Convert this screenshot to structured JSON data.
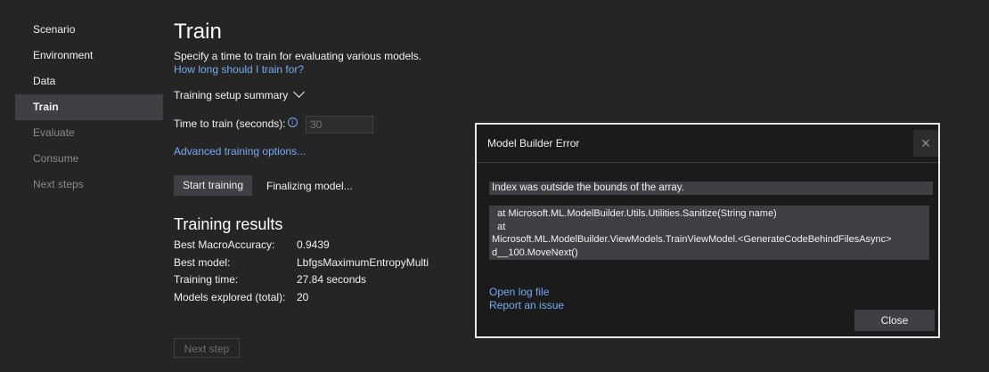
{
  "sidebar": {
    "items": [
      {
        "label": "Scenario",
        "state": "normal"
      },
      {
        "label": "Environment",
        "state": "normal"
      },
      {
        "label": "Data",
        "state": "normal"
      },
      {
        "label": "Train",
        "state": "active"
      },
      {
        "label": "Evaluate",
        "state": "disabled"
      },
      {
        "label": "Consume",
        "state": "disabled"
      },
      {
        "label": "Next steps",
        "state": "disabled"
      }
    ]
  },
  "main": {
    "title": "Train",
    "description": "Specify a time to train for evaluating various models.",
    "how_long_link": "How long should I train for?",
    "setup_summary": "Training setup summary",
    "time_to_train_label": "Time to train (seconds):",
    "info_glyph": "i",
    "time_to_train_placeholder": "30",
    "advanced_link": "Advanced training options...",
    "start_button": "Start training",
    "status": "Finalizing model...",
    "results_title": "Training results",
    "results": [
      {
        "label": "Best MacroAccuracy:",
        "value": "0.9439"
      },
      {
        "label": "Best model:",
        "value": "LbfgsMaximumEntropyMulti"
      },
      {
        "label": "Training time:",
        "value": "27.84 seconds"
      },
      {
        "label": "Models explored (total):",
        "value": "20"
      }
    ],
    "next_step_button": "Next step"
  },
  "dialog": {
    "title": "Model Builder Error",
    "close_glyph": "✕",
    "message": "Index was outside the bounds of the array.",
    "stack_trace": "  at Microsoft.ML.ModelBuilder.Utils.Utilities.Sanitize(String name)\n  at\nMicrosoft.ML.ModelBuilder.ViewModels.TrainViewModel.<GenerateCodeBehindFilesAsync>\nd__100.MoveNext()",
    "open_log_link": "Open log file",
    "report_link": "Report an issue",
    "close_button": "Close"
  },
  "colors": {
    "background": "#252526",
    "link": "#77aaf0",
    "selected_nav": "#3f3f46",
    "dialog_border": "#e8e8e8"
  }
}
